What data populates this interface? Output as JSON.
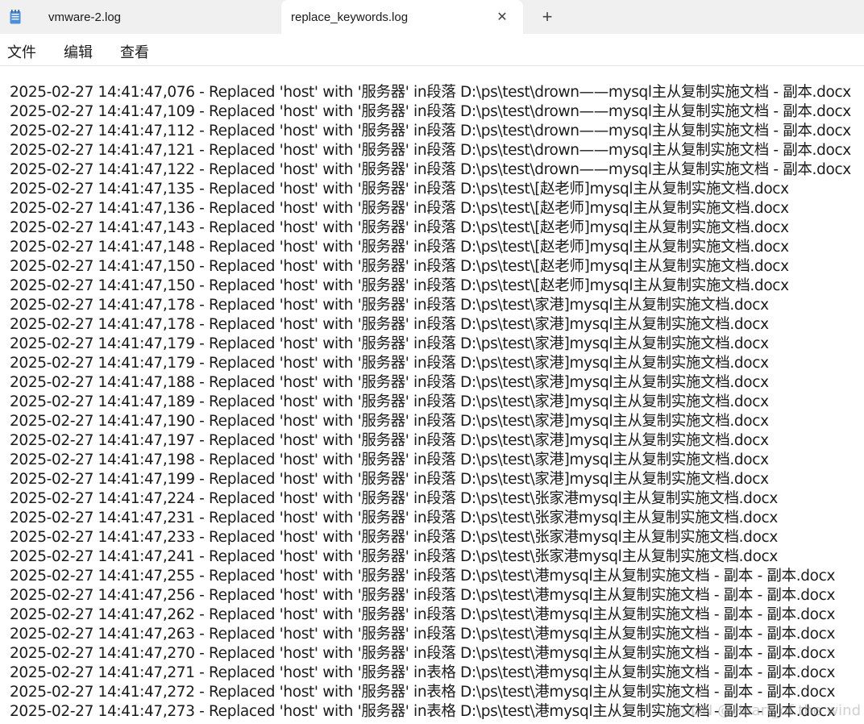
{
  "tabs": [
    {
      "label": "vmware-2.log",
      "active": false,
      "icon": "notepad-icon"
    },
    {
      "label": "replace_keywords.log",
      "active": true
    }
  ],
  "tab_close_glyph": "✕",
  "new_tab_glyph": "+",
  "menu": {
    "file": "文件",
    "edit": "编辑",
    "view": "查看"
  },
  "log_lines": [
    "2025-02-27 14:41:47,076 - Replaced 'host' with '服务器' in段落 D:\\ps\\test\\drown——mysql主从复制实施文档 - 副本.docx",
    "2025-02-27 14:41:47,109 - Replaced 'host' with '服务器' in段落 D:\\ps\\test\\drown——mysql主从复制实施文档 - 副本.docx",
    "2025-02-27 14:41:47,112 - Replaced 'host' with '服务器' in段落 D:\\ps\\test\\drown——mysql主从复制实施文档 - 副本.docx",
    "2025-02-27 14:41:47,121 - Replaced 'host' with '服务器' in段落 D:\\ps\\test\\drown——mysql主从复制实施文档 - 副本.docx",
    "2025-02-27 14:41:47,122 - Replaced 'host' with '服务器' in段落 D:\\ps\\test\\drown——mysql主从复制实施文档 - 副本.docx",
    "2025-02-27 14:41:47,135 - Replaced 'host' with '服务器' in段落 D:\\ps\\test\\[赵老师]mysql主从复制实施文档.docx",
    "2025-02-27 14:41:47,136 - Replaced 'host' with '服务器' in段落 D:\\ps\\test\\[赵老师]mysql主从复制实施文档.docx",
    "2025-02-27 14:41:47,143 - Replaced 'host' with '服务器' in段落 D:\\ps\\test\\[赵老师]mysql主从复制实施文档.docx",
    "2025-02-27 14:41:47,148 - Replaced 'host' with '服务器' in段落 D:\\ps\\test\\[赵老师]mysql主从复制实施文档.docx",
    "2025-02-27 14:41:47,150 - Replaced 'host' with '服务器' in段落 D:\\ps\\test\\[赵老师]mysql主从复制实施文档.docx",
    "2025-02-27 14:41:47,150 - Replaced 'host' with '服务器' in段落 D:\\ps\\test\\[赵老师]mysql主从复制实施文档.docx",
    "2025-02-27 14:41:47,178 - Replaced 'host' with '服务器' in段落 D:\\ps\\test\\家港]mysql主从复制实施文档.docx",
    "2025-02-27 14:41:47,178 - Replaced 'host' with '服务器' in段落 D:\\ps\\test\\家港]mysql主从复制实施文档.docx",
    "2025-02-27 14:41:47,179 - Replaced 'host' with '服务器' in段落 D:\\ps\\test\\家港]mysql主从复制实施文档.docx",
    "2025-02-27 14:41:47,179 - Replaced 'host' with '服务器' in段落 D:\\ps\\test\\家港]mysql主从复制实施文档.docx",
    "2025-02-27 14:41:47,188 - Replaced 'host' with '服务器' in段落 D:\\ps\\test\\家港]mysql主从复制实施文档.docx",
    "2025-02-27 14:41:47,189 - Replaced 'host' with '服务器' in段落 D:\\ps\\test\\家港]mysql主从复制实施文档.docx",
    "2025-02-27 14:41:47,190 - Replaced 'host' with '服务器' in段落 D:\\ps\\test\\家港]mysql主从复制实施文档.docx",
    "2025-02-27 14:41:47,197 - Replaced 'host' with '服务器' in段落 D:\\ps\\test\\家港]mysql主从复制实施文档.docx",
    "2025-02-27 14:41:47,198 - Replaced 'host' with '服务器' in段落 D:\\ps\\test\\家港]mysql主从复制实施文档.docx",
    "2025-02-27 14:41:47,199 - Replaced 'host' with '服务器' in段落 D:\\ps\\test\\家港]mysql主从复制实施文档.docx",
    "2025-02-27 14:41:47,224 - Replaced 'host' with '服务器' in段落 D:\\ps\\test\\张家港mysql主从复制实施文档.docx",
    "2025-02-27 14:41:47,231 - Replaced 'host' with '服务器' in段落 D:\\ps\\test\\张家港mysql主从复制实施文档.docx",
    "2025-02-27 14:41:47,233 - Replaced 'host' with '服务器' in段落 D:\\ps\\test\\张家港mysql主从复制实施文档.docx",
    "2025-02-27 14:41:47,241 - Replaced 'host' with '服务器' in段落 D:\\ps\\test\\张家港mysql主从复制实施文档.docx",
    "2025-02-27 14:41:47,255 - Replaced 'host' with '服务器' in段落 D:\\ps\\test\\港mysql主从复制实施文档 - 副本 - 副本.docx",
    "2025-02-27 14:41:47,256 - Replaced 'host' with '服务器' in段落 D:\\ps\\test\\港mysql主从复制实施文档 - 副本 - 副本.docx",
    "2025-02-27 14:41:47,262 - Replaced 'host' with '服务器' in段落 D:\\ps\\test\\港mysql主从复制实施文档 - 副本 - 副本.docx",
    "2025-02-27 14:41:47,263 - Replaced 'host' with '服务器' in段落 D:\\ps\\test\\港mysql主从复制实施文档 - 副本 - 副本.docx",
    "2025-02-27 14:41:47,270 - Replaced 'host' with '服务器' in段落 D:\\ps\\test\\港mysql主从复制实施文档 - 副本 - 副本.docx",
    "2025-02-27 14:41:47,271 - Replaced 'host' with '服务器' in表格 D:\\ps\\test\\港mysql主从复制实施文档 - 副本 - 副本.docx",
    "2025-02-27 14:41:47,272 - Replaced 'host' with '服务器' in表格 D:\\ps\\test\\港mysql主从复制实施文档 - 副本 - 副本.docx",
    "2025-02-27 14:41:47,273 - Replaced 'host' with '服务器' in表格 D:\\ps\\test\\港mysql主从复制实施文档 - 副本 - 副本.docx"
  ],
  "watermark": "CSDN @Heart_of the wind"
}
